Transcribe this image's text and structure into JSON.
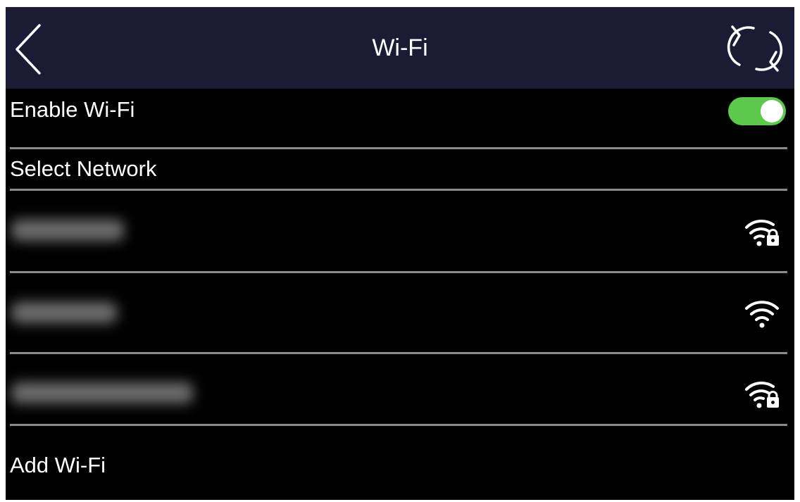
{
  "header": {
    "title": "Wi-Fi",
    "back_icon": "chevron-left-icon",
    "refresh_icon": "refresh-icon"
  },
  "enable_wifi": {
    "label": "Enable Wi-Fi",
    "enabled": true,
    "toggle_color": "#5cc84c"
  },
  "select_network": {
    "label": "Select Network"
  },
  "networks": [
    {
      "secured": true,
      "icon": "wifi-lock-icon"
    },
    {
      "secured": false,
      "icon": "wifi-icon"
    },
    {
      "secured": true,
      "icon": "wifi-lock-icon"
    }
  ],
  "add_wifi": {
    "label": "Add Wi-Fi"
  },
  "colors": {
    "header_bg": "#1b1b35",
    "screen_bg": "#000000",
    "divider": "#8a8a8a",
    "text": "#ffffff"
  }
}
